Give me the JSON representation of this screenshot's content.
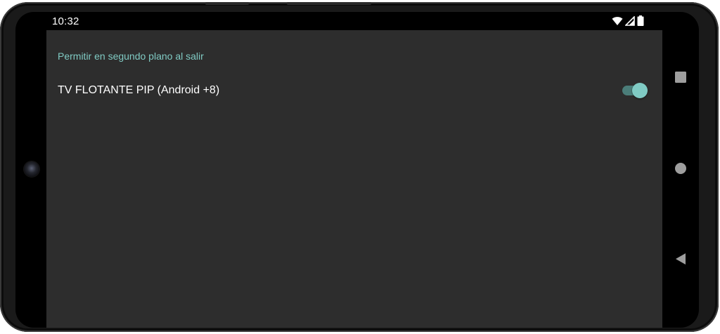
{
  "status_bar": {
    "time": "10:32",
    "icons": [
      "wifi-icon",
      "cell-signal-icon",
      "battery-icon"
    ]
  },
  "preferences": {
    "category_title": "Permitir en segundo plano al salir",
    "items": [
      {
        "title": "TV FLOTANTE PIP (Android +8)",
        "switch_on": true
      }
    ]
  },
  "navigation_bar": {
    "buttons": [
      "recents-icon",
      "home-icon",
      "back-icon"
    ]
  },
  "colors": {
    "accent": "#80cbc4",
    "background": "#2d2d2d",
    "text_primary": "#ffffff"
  }
}
